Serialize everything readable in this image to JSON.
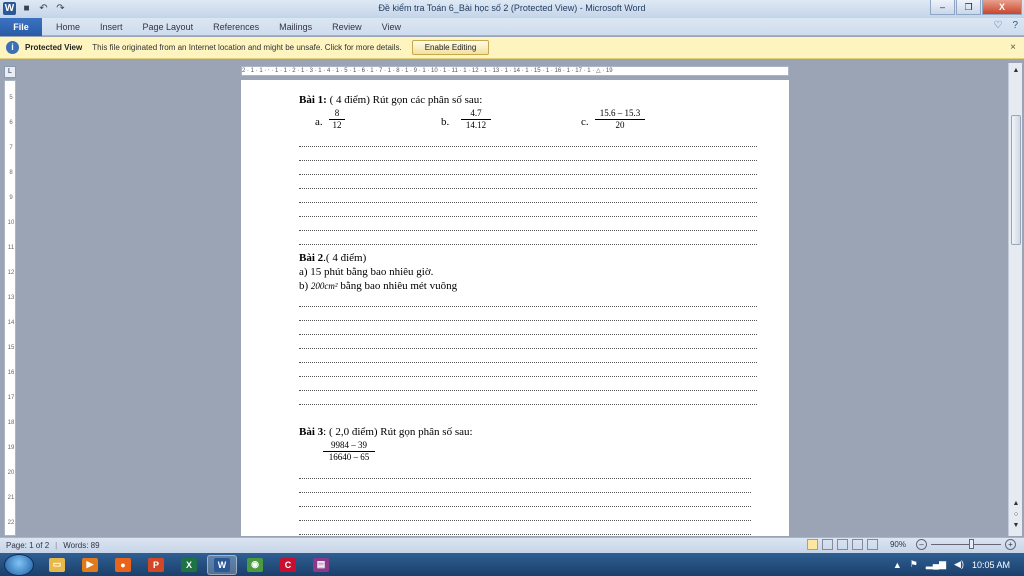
{
  "app": {
    "title": "Đề kiểm tra Toán 6_Bài học số 2 (Protected View)  -  Microsoft Word"
  },
  "qat": {
    "logo": "W",
    "save_icon": "floppy-icon",
    "undo": "↶",
    "redo": "↷"
  },
  "window_controls": {
    "minimize": "–",
    "restore": "❐",
    "close": "X"
  },
  "ribbon": {
    "file_label": "File",
    "tabs": [
      "Home",
      "Insert",
      "Page Layout",
      "References",
      "Mailings",
      "Review",
      "View"
    ],
    "help_icon": "?"
  },
  "protected_view": {
    "label": "Protected View",
    "message": "This file originated from an Internet location and might be unsafe. Click for more details.",
    "button": "Enable Editing",
    "close": "×"
  },
  "ruler": {
    "h_ticks": "2 · 1 · 1 · ⸱ · 1 · 1 · 2 · 1 · 3 · 1 · 4 · 1 · 5 · 1 · 6 · 1 · 7 · 1 · 8 · 1 · 9 · 1 · 10 · 1 · 11 · 1 · 12 · 1 · 13 · 1 · 14 · 1 · 15 · 1 · 16 · 1 · 17 · 1 · △ · 19",
    "corner": "L",
    "v_ticks": [
      "5",
      "6",
      "7",
      "8",
      "9",
      "10",
      "11",
      "12",
      "13",
      "14",
      "15",
      "16",
      "17",
      "18",
      "19",
      "20",
      "21",
      "22"
    ]
  },
  "document": {
    "bai1": {
      "title": "Bài 1:",
      "heading": " ( 4 điểm)  Rút gọn các phân số sau:",
      "a_label": "a.",
      "a_num": "8",
      "a_den": "12",
      "b_label": "b.",
      "b_num": "4.7",
      "b_den": "14.12",
      "c_label": "c.",
      "c_num": "15.6 – 15.3",
      "c_den": "20"
    },
    "bai2": {
      "title": "Bài 2",
      "heading": ".( 4 điểm)",
      "line_a": "a) 15 phút bằng bao nhiêu giờ.",
      "line_b_pre": " b) ",
      "line_b_math": "200cm²",
      "line_b_post": "  bằng bao nhiêu mét vuông"
    },
    "bai3": {
      "title": "Bài 3",
      "heading": ": ( 2,0 điểm)  Rút gọn phân số sau:",
      "num": "9984 – 39",
      "den": "16640 – 65"
    }
  },
  "status": {
    "page": "Page: 1 of 2",
    "words": "Words: 89",
    "zoom": "90%",
    "zoom_minus": "–",
    "zoom_plus": "+"
  },
  "taskbar": {
    "items": [
      {
        "name": "explorer",
        "glyph": "▭",
        "color": "#e8b84a"
      },
      {
        "name": "media",
        "glyph": "▶",
        "color": "#e27a1b"
      },
      {
        "name": "firefox",
        "glyph": "●",
        "color": "#e8641b"
      },
      {
        "name": "powerpoint",
        "glyph": "P",
        "color": "#d24726"
      },
      {
        "name": "excel",
        "glyph": "X",
        "color": "#1f7244"
      },
      {
        "name": "word",
        "glyph": "W",
        "color": "#2b5797"
      },
      {
        "name": "chrome",
        "glyph": "◉",
        "color": "#4a9b3f"
      },
      {
        "name": "app-red",
        "glyph": "C",
        "color": "#c8102e"
      },
      {
        "name": "app-archive",
        "glyph": "▤",
        "color": "#8b3a8b"
      }
    ],
    "tray": {
      "flag": "⚑",
      "volume": "◀)",
      "signal": "▂▄▆",
      "clock": "10:05 AM"
    }
  }
}
